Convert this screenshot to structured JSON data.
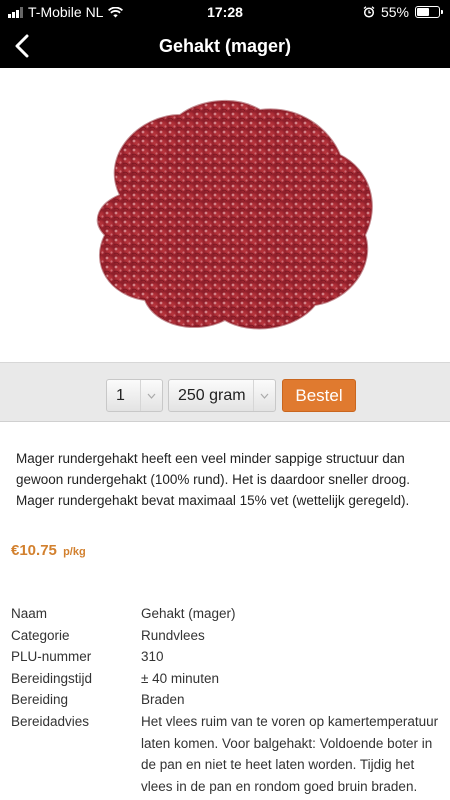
{
  "status": {
    "carrier": "T-Mobile NL",
    "time": "17:28",
    "battery": "55%",
    "battery_level": 0.55
  },
  "nav": {
    "title": "Gehakt (mager)",
    "back_icon": "chevron-left-icon"
  },
  "hero": {
    "image": "minced-meat-photo"
  },
  "order": {
    "quantity": "1",
    "weight": "250 gram",
    "order_label": "Bestel"
  },
  "description": "Mager rundergehakt heeft een veel minder sappige structuur dan gewoon rundergehakt (100% rund). Het is daardoor sneller droog. Mager rundergehakt bevat maximaal 15% vet (wettelijk geregeld).",
  "price": {
    "value": "€10.75",
    "unit": "p/kg",
    "color": "#d2802e"
  },
  "details": [
    {
      "key": "Naam",
      "value": "Gehakt (mager)"
    },
    {
      "key": "Categorie",
      "value": "Rundvlees"
    },
    {
      "key": "PLU-nummer",
      "value": "310"
    },
    {
      "key": "Bereidingstijd",
      "value": "± 40 minuten"
    },
    {
      "key": "Bereiding",
      "value": "Braden"
    },
    {
      "key": "Bereidadvies",
      "value": "Het vlees ruim van te voren op kamertemperatuur laten komen. Voor balgehakt: Voldoende boter in de pan en niet te heet laten worden. Tijdig het vlees in de pan en rondom goed bruin braden. Daarna een"
    }
  ],
  "accent_color": "#e07a2f"
}
